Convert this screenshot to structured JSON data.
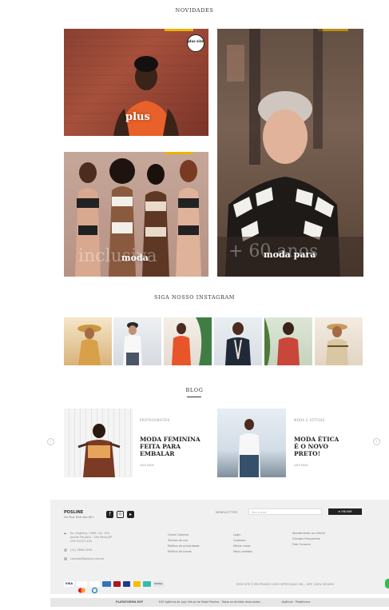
{
  "sections": {
    "novidades": "NOVIDADES",
    "instagram": "SIGA NOSSO INSTAGRAM",
    "blog": "BLOG"
  },
  "tiles": {
    "plus": {
      "label": "plus",
      "badge": "plus size"
    },
    "moda_inclusiva": {
      "label": "moda",
      "ghost": "inclusiva"
    },
    "moda_60": {
      "label": "moda para",
      "ghost": "+ 60 anos"
    }
  },
  "blog": {
    "posts": [
      {
        "category": "PROTAGONISTAS",
        "title": "MODA FEMININA FEITA PARA EMBALAR",
        "more": "LEIA MAIS"
      },
      {
        "category": "MODA E ATITUDE",
        "title": "MODA ÉTICA É O NOVO PRETO!",
        "more": "LEIA MAIS"
      }
    ],
    "prev": "‹",
    "next": "›"
  },
  "footer": {
    "brand": "POSLINE",
    "subtitle": "Do Plus Size Aos 60+",
    "address": [
      "Av. Angelica, 2489, Cjs. 104,",
      "Jardim Paulista - São Paulo/SP",
      "CEP 01227-200"
    ],
    "phone": "(11) 3899-4299",
    "email": "contato@posline.com.br",
    "links_col1": [
      "Como Comprar",
      "Termos de uso",
      "Política de privacidade",
      "Política de trocas"
    ],
    "links_col2": [
      "Login",
      "Cadastro",
      "Minha conta",
      "Meus pedidos"
    ],
    "links_col3": [
      "Atendimento ao cliente",
      "Dúvidas Frequentes",
      "Fale Conosco"
    ],
    "newsletter_label": "NEWSLETTER",
    "newsletter_placeholder": "Seu e-mail",
    "newsletter_button": "ENVIAR",
    "payments": [
      "VISA",
      "MC",
      "DINERS",
      "AMEX",
      "HIPER",
      "ELO",
      "BOLETO",
      "PIX",
      "PAYPAL"
    ],
    "security_text": "ESSE SITE É PROTEGIDO COM CERTIFICADO SSL - SITE 100% SEGURO"
  },
  "bottom_bar": {
    "platform": "PLATAFORMA EXP",
    "legal": "EXP Agência de Loja Virtual de Moda Posline - Todos os direitos reservados",
    "partners": "Agência · Plataforma"
  },
  "colors": {
    "accent": "#e9b400",
    "footer_bg": "#f0f0f0",
    "button_dark": "#222222",
    "help_green": "#2ec04a"
  }
}
